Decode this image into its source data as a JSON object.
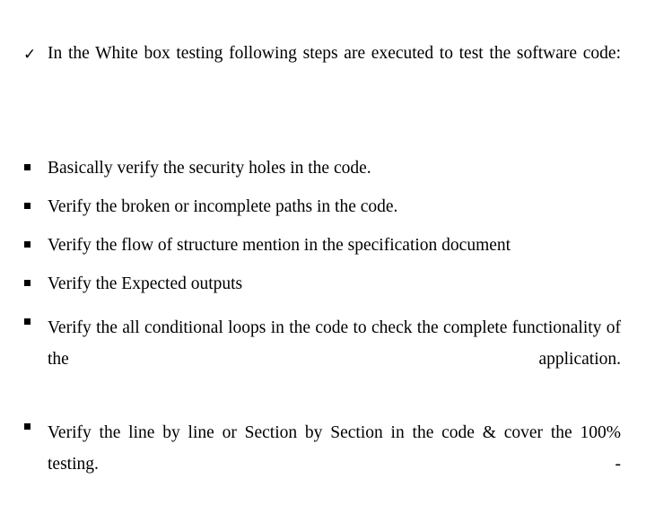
{
  "slide": {
    "background_color": "#ffffff",
    "text_color": "#000000",
    "intro": {
      "marker": "check-mark",
      "marker_glyph": "✓",
      "text": "In the White box testing following steps are executed to test the software code:"
    },
    "bullets": {
      "marker": "small-filled-square",
      "marker_glyph": "▪",
      "items": [
        {
          "text": "Basically verify the security holes in the code.",
          "multiline": false
        },
        {
          "text": "Verify the broken or incomplete paths in the code.",
          "multiline": false
        },
        {
          "text": "Verify the flow of structure mention in the specification document",
          "multiline": false
        },
        {
          "text": "Verify the Expected outputs",
          "multiline": false
        },
        {
          "text": "Verify the all conditional loops in the code to check the complete functionality of the application.",
          "multiline": true
        },
        {
          "text": "Verify the line by line or Section by Section in the code & cover the 100% testing. -",
          "multiline": true
        }
      ]
    }
  }
}
